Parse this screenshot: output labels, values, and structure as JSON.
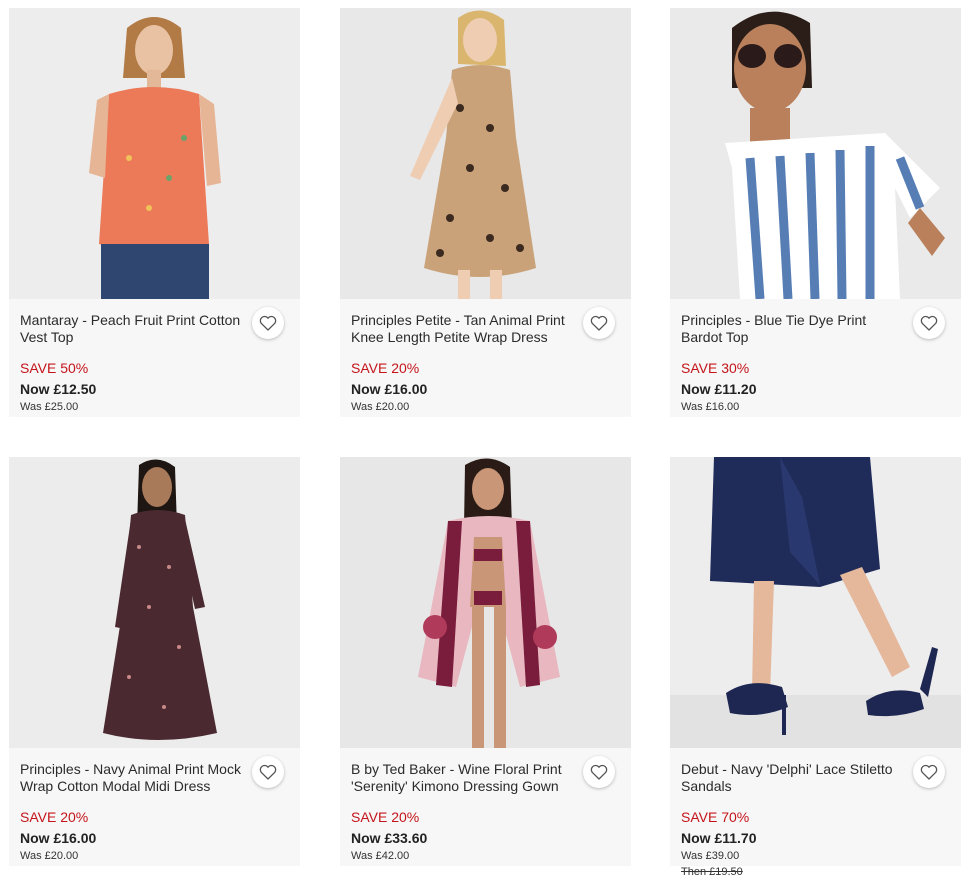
{
  "colors": {
    "save_red": "#c4141a",
    "card_bg": "#f7f7f7"
  },
  "products": [
    {
      "name": "Mantaray - Peach Fruit Print Cotton Vest Top",
      "save": "SAVE 50%",
      "now": "Now £12.50",
      "was": "Was £25.00",
      "then": null,
      "wishlist_icon": "heart-outline-icon",
      "image": "model-peach-vest-top"
    },
    {
      "name": "Principles Petite - Tan Animal Print Knee Length Petite Wrap Dress",
      "save": "SAVE 20%",
      "now": "Now £16.00",
      "was": "Was £20.00",
      "then": null,
      "wishlist_icon": "heart-outline-icon",
      "image": "model-animal-print-dress"
    },
    {
      "name": "Principles - Blue Tie Dye Print Bardot Top",
      "save": "SAVE 30%",
      "now": "Now £11.20",
      "was": "Was £16.00",
      "then": null,
      "wishlist_icon": "heart-outline-icon",
      "image": "model-tie-dye-bardot-top"
    },
    {
      "name": "Principles - Navy Animal Print Mock Wrap Cotton Modal Midi Dress",
      "save": "SAVE 20%",
      "now": "Now £16.00",
      "was": "Was £20.00",
      "then": null,
      "wishlist_icon": "heart-outline-icon",
      "image": "model-navy-midi-dress"
    },
    {
      "name": "B by Ted Baker - Wine Floral Print 'Serenity' Kimono Dressing Gown",
      "save": "SAVE 20%",
      "now": "Now £33.60",
      "was": "Was £42.00",
      "then": null,
      "wishlist_icon": "heart-outline-icon",
      "image": "model-floral-kimono"
    },
    {
      "name": "Debut - Navy 'Delphi' Lace Stiletto Sandals",
      "save": "SAVE 70%",
      "now": "Now £11.70",
      "was": "Was £39.00",
      "then": "Then £19.50",
      "wishlist_icon": "heart-outline-icon",
      "image": "navy-lace-stiletto-sandals"
    }
  ]
}
